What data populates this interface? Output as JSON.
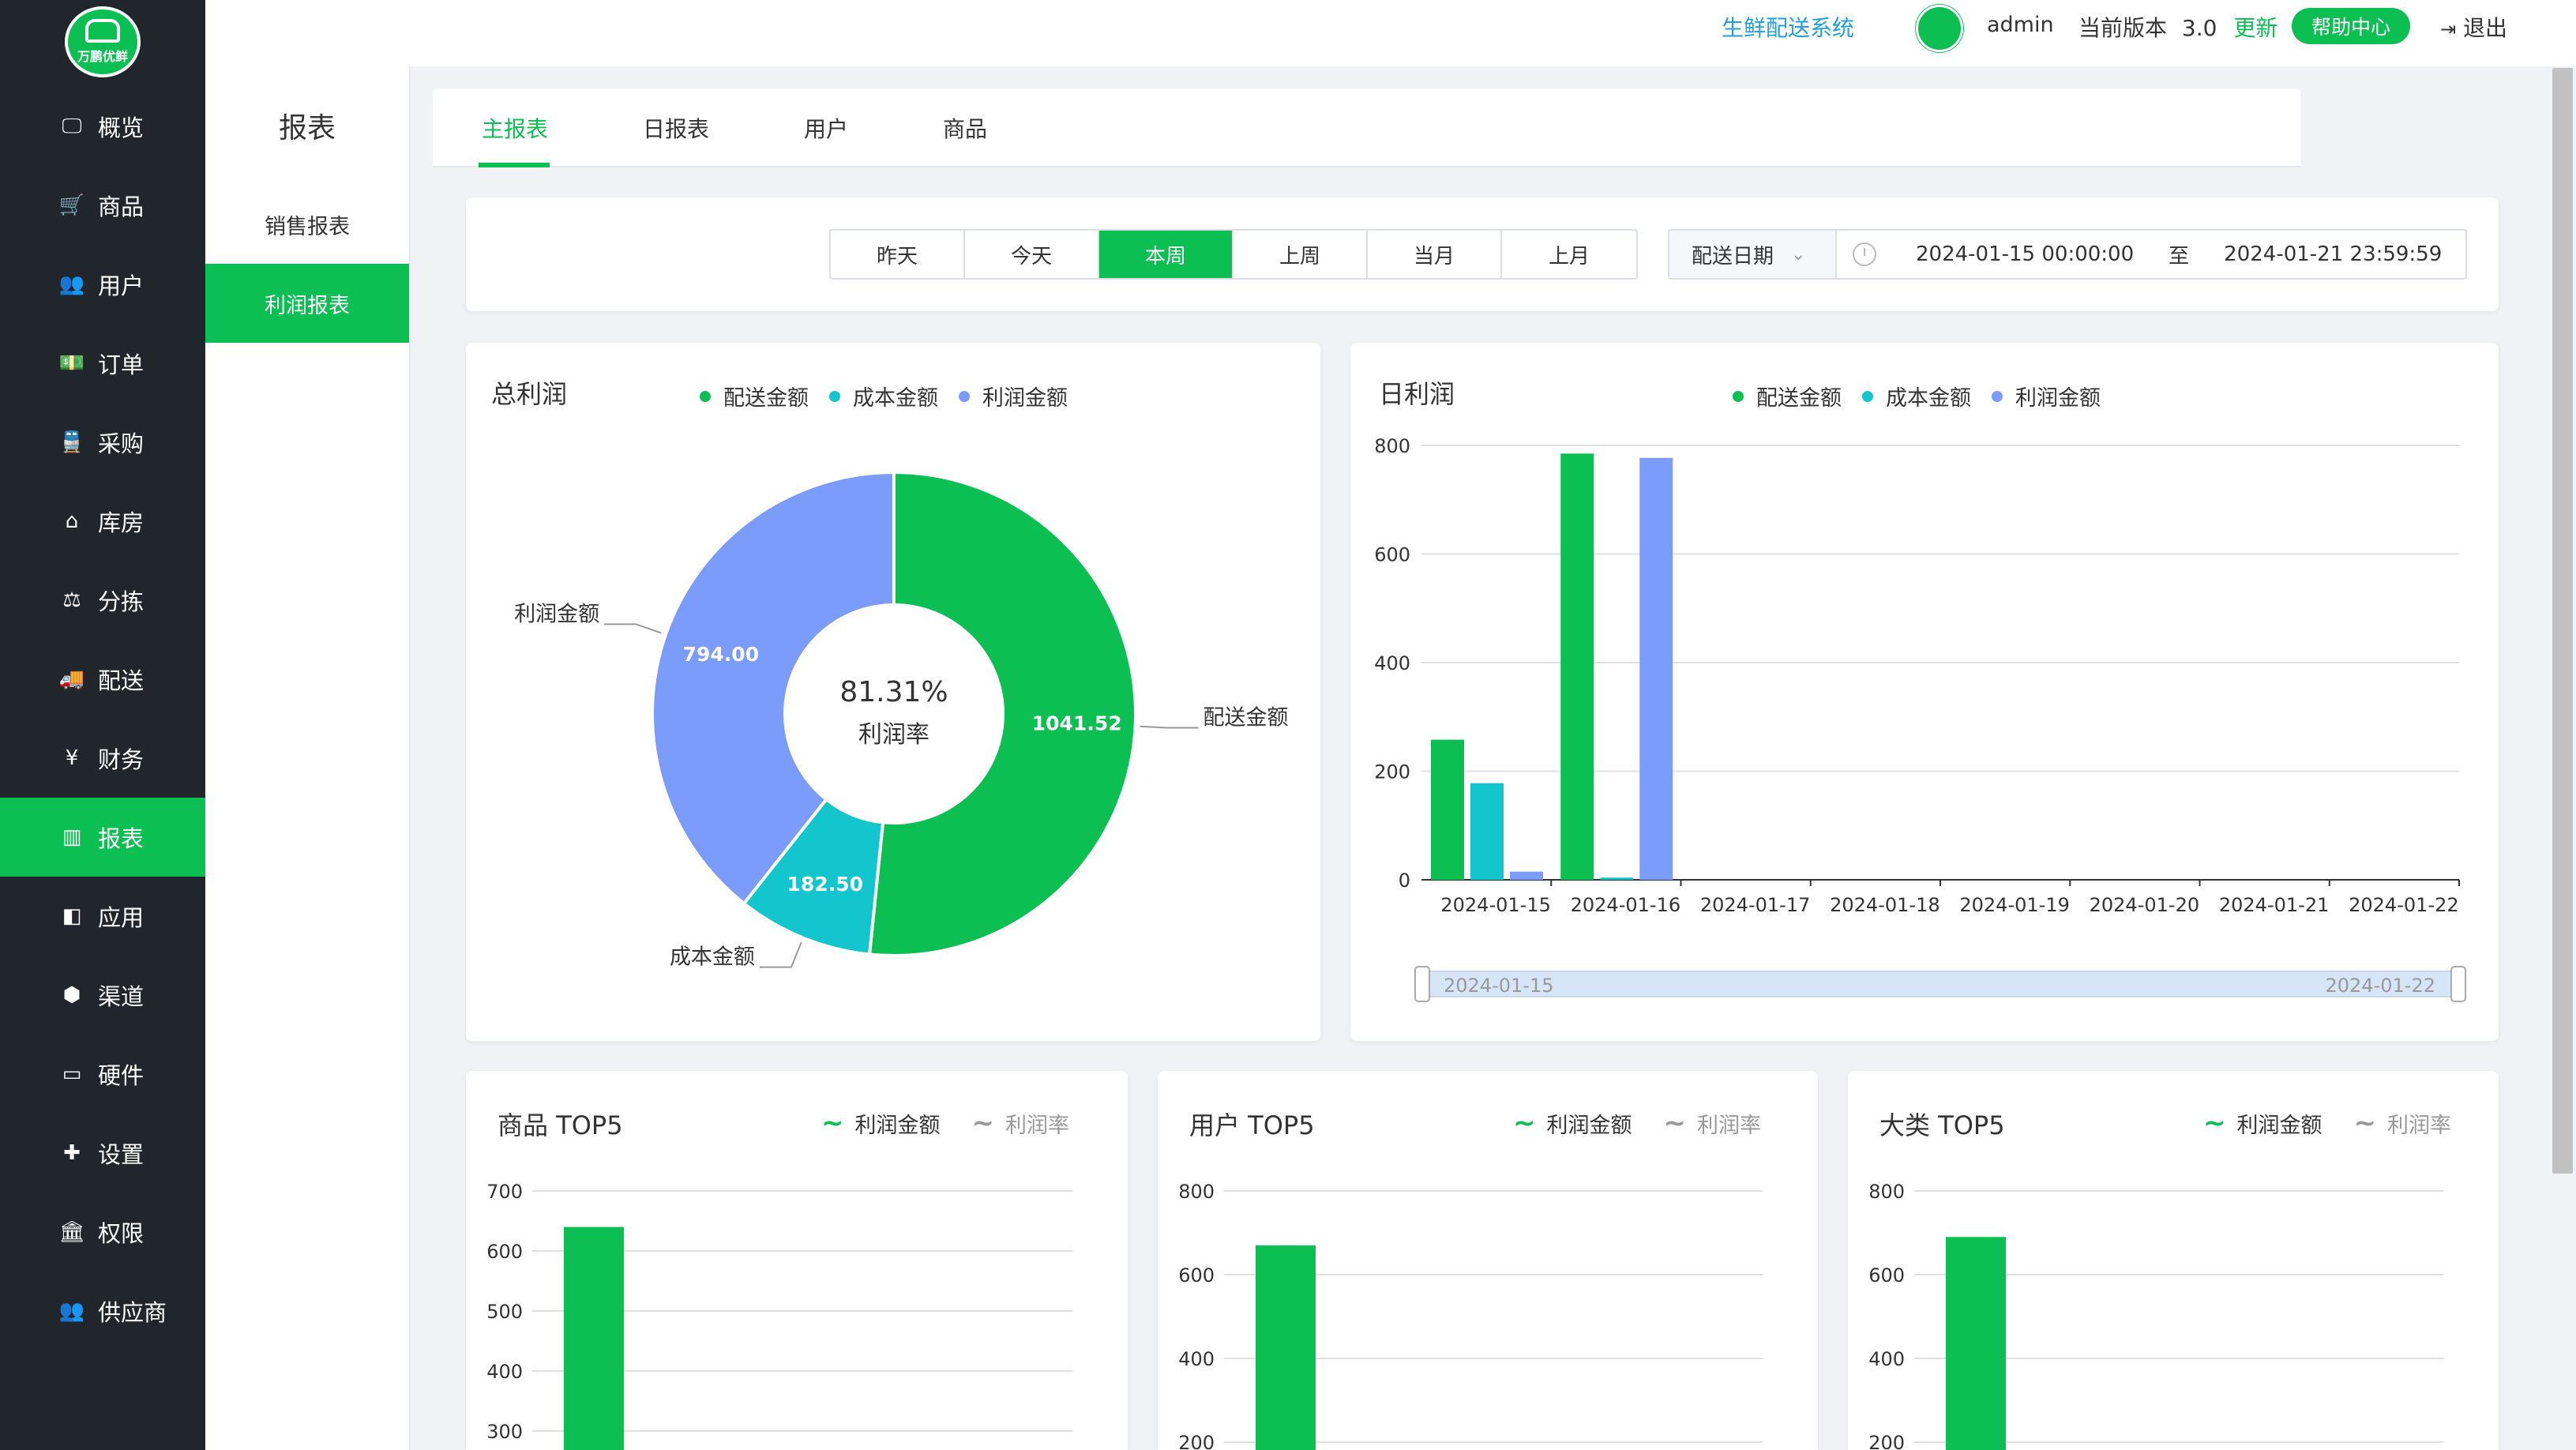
{
  "sidebar": {
    "logo_text": "万鹏优鲜",
    "items": [
      {
        "label": "概览",
        "icon": "monitor-icon"
      },
      {
        "label": "商品",
        "icon": "cart-icon"
      },
      {
        "label": "用户",
        "icon": "users-icon"
      },
      {
        "label": "订单",
        "icon": "money-icon"
      },
      {
        "label": "采购",
        "icon": "train-icon"
      },
      {
        "label": "库房",
        "icon": "home-icon"
      },
      {
        "label": "分拣",
        "icon": "scale-icon"
      },
      {
        "label": "配送",
        "icon": "truck-icon"
      },
      {
        "label": "财务",
        "icon": "yen-icon"
      },
      {
        "label": "报表",
        "icon": "bar-chart-icon",
        "active": true
      },
      {
        "label": "应用",
        "icon": "apps-icon"
      },
      {
        "label": "渠道",
        "icon": "cube-icon"
      },
      {
        "label": "硬件",
        "icon": "desktop-icon"
      },
      {
        "label": "设置",
        "icon": "puzzle-icon"
      },
      {
        "label": "权限",
        "icon": "bank-icon"
      },
      {
        "label": "供应商",
        "icon": "group-icon"
      }
    ]
  },
  "subside": {
    "title": "报表",
    "items": [
      {
        "label": "销售报表"
      },
      {
        "label": "利润报表",
        "active": true
      }
    ]
  },
  "topbar": {
    "system": "生鲜配送系统",
    "user": "admin",
    "version_label": "当前版本",
    "version": "3.0",
    "update": "更新",
    "help": "帮助中心",
    "logout": "退出"
  },
  "tabs": [
    "主报表",
    "日报表",
    "用户",
    "商品"
  ],
  "filter": {
    "periods": [
      "昨天",
      "今天",
      "本周",
      "上周",
      "当月",
      "上月"
    ],
    "active_period": "本周",
    "date_type": "配送日期",
    "start": "2024-01-15 00:00:00",
    "sep": "至",
    "end": "2024-01-21 23:59:59"
  },
  "colors": {
    "green": "#0cbf52",
    "cyan": "#13c6ce",
    "blue": "#7b9cfa",
    "gray": "#999999"
  },
  "pie": {
    "title": "总利润",
    "legend": [
      "配送金额",
      "成本金额",
      "利润金额"
    ],
    "center_value": "81.31%",
    "center_label": "利润率",
    "chart_data": {
      "type": "pie",
      "slices": [
        {
          "name": "配送金额",
          "value": 1041.52,
          "label": "1041.52"
        },
        {
          "name": "成本金额",
          "value": 182.5,
          "label": "182.50"
        },
        {
          "name": "利润金额",
          "value": 794.0,
          "label": "794.00"
        }
      ]
    }
  },
  "daily": {
    "title": "日利润",
    "legend": [
      "配送金额",
      "成本金额",
      "利润金额"
    ],
    "zoom_start": "2024-01-15",
    "zoom_end": "2024-01-22",
    "chart_data": {
      "type": "bar",
      "categories": [
        "2024-01-15",
        "2024-01-16",
        "2024-01-17",
        "2024-01-18",
        "2024-01-19",
        "2024-01-20",
        "2024-01-21",
        "2024-01-22"
      ],
      "series": [
        {
          "name": "配送金额",
          "values": [
            258,
            785,
            0,
            0,
            0,
            0,
            0,
            0
          ]
        },
        {
          "name": "成本金额",
          "values": [
            178,
            4,
            0,
            0,
            0,
            0,
            0,
            0
          ]
        },
        {
          "name": "利润金额",
          "values": [
            15,
            777,
            0,
            0,
            0,
            0,
            0,
            0
          ]
        }
      ],
      "yticks": [
        0,
        200,
        400,
        600,
        800
      ],
      "ylim": [
        0,
        800
      ]
    }
  },
  "tops": [
    {
      "title": "商品 TOP5",
      "legend": [
        "利润金额",
        "利润率"
      ],
      "chart_data": {
        "type": "bar",
        "series": [
          {
            "name": "利润金额",
            "values": [
              640
            ]
          }
        ],
        "yticks": [
          300,
          400,
          500,
          600,
          700
        ],
        "ylim": [
          0,
          700
        ]
      }
    },
    {
      "title": "用户 TOP5",
      "legend": [
        "利润金额",
        "利润率"
      ],
      "chart_data": {
        "type": "bar",
        "series": [
          {
            "name": "利润金额",
            "values": [
              670
            ]
          }
        ],
        "yticks": [
          200,
          400,
          600,
          800
        ],
        "ylim": [
          0,
          800
        ]
      }
    },
    {
      "title": "大类 TOP5",
      "legend": [
        "利润金额",
        "利润率"
      ],
      "chart_data": {
        "type": "bar",
        "series": [
          {
            "name": "利润金额",
            "values": [
              690
            ]
          }
        ],
        "yticks": [
          200,
          400,
          600,
          800
        ],
        "ylim": [
          0,
          800
        ]
      }
    }
  ]
}
